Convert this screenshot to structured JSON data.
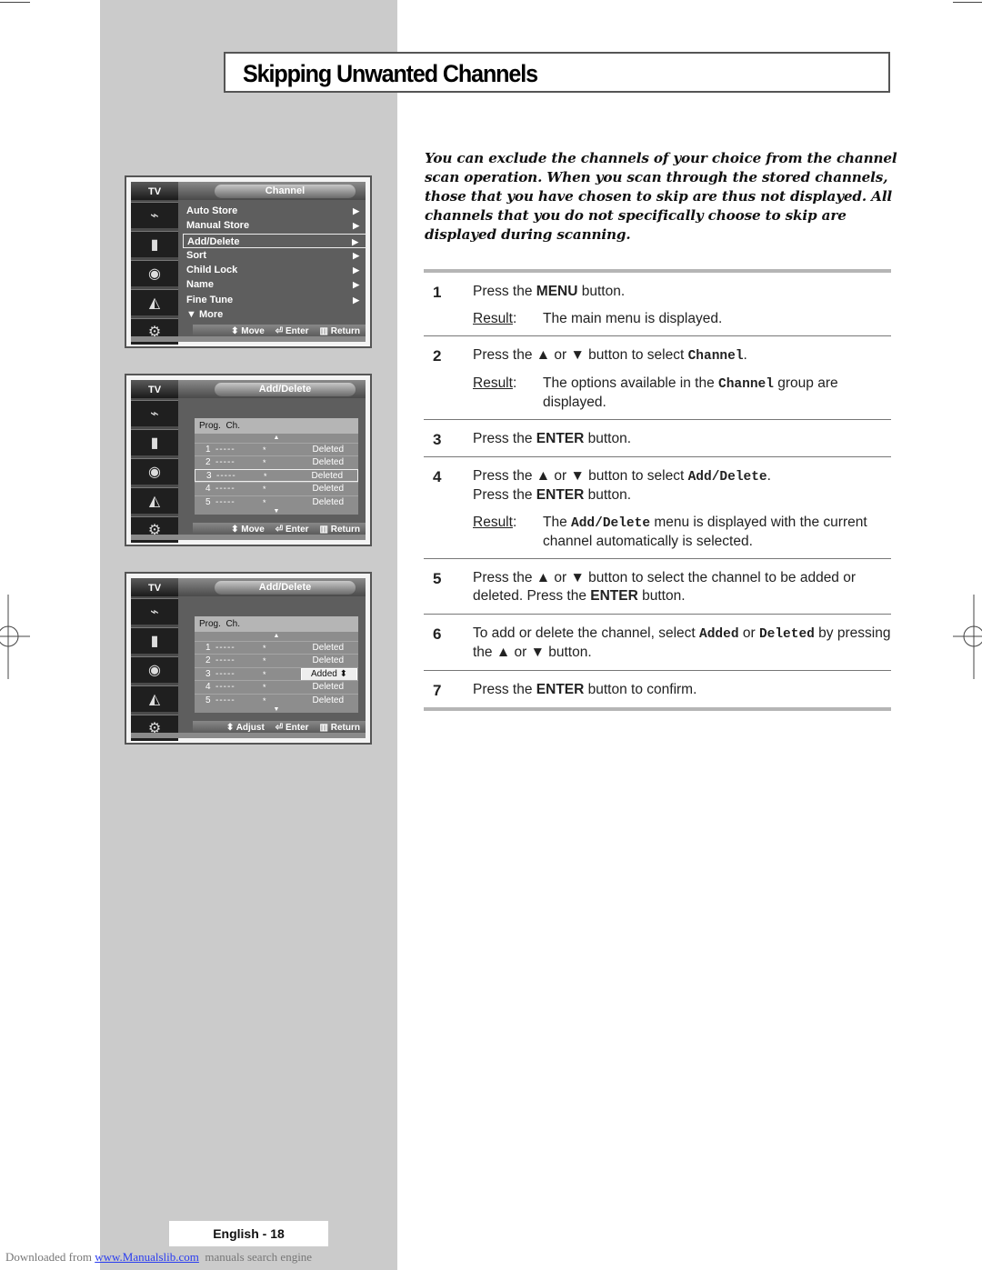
{
  "page": {
    "title": "Skipping Unwanted Channels",
    "intro": "You can exclude the channels of your choice from the channel scan operation. When you scan through the stored channels, those that you have chosen to skip are thus not displayed. All channels that you do not specifically choose to skip are displayed during scanning.",
    "page_number": "English - 18"
  },
  "steps": [
    {
      "num": "1",
      "parts": [
        [
          "Press the ",
          ""
        ],
        [
          "MENU",
          "b"
        ],
        [
          " button.",
          ""
        ]
      ],
      "result_label": "Result",
      "result": [
        [
          "The main menu is displayed.",
          ""
        ]
      ]
    },
    {
      "num": "2",
      "parts": [
        [
          "Press the ▲ or ▼ button to select ",
          ""
        ],
        [
          "Channel",
          "mono"
        ],
        [
          ".",
          ""
        ]
      ],
      "result_label": "Result",
      "result": [
        [
          "The options available in the ",
          ""
        ],
        [
          "Channel",
          "mono"
        ],
        [
          " group are displayed.",
          ""
        ]
      ]
    },
    {
      "num": "3",
      "parts": [
        [
          "Press the ",
          ""
        ],
        [
          "ENTER",
          "b"
        ],
        [
          " button.",
          ""
        ]
      ]
    },
    {
      "num": "4",
      "parts": [
        [
          "Press the ▲ or ▼ button to select ",
          ""
        ],
        [
          "Add/Delete",
          "mono"
        ],
        [
          ".",
          ""
        ],
        [
          "\n",
          "br"
        ],
        [
          "Press the ",
          ""
        ],
        [
          "ENTER",
          "b"
        ],
        [
          " button.",
          ""
        ]
      ],
      "result_label": "Result",
      "result": [
        [
          "The ",
          ""
        ],
        [
          "Add/Delete",
          "mono"
        ],
        [
          " menu is displayed with the current channel automatically is selected.",
          ""
        ]
      ]
    },
    {
      "num": "5",
      "parts": [
        [
          "Press the ▲ or ▼ button to select the channel to be added or deleted. Press the ",
          ""
        ],
        [
          "ENTER",
          "b"
        ],
        [
          " button.",
          ""
        ]
      ]
    },
    {
      "num": "6",
      "parts": [
        [
          "To add or delete the channel, select ",
          ""
        ],
        [
          "Added",
          "mono"
        ],
        [
          " or ",
          ""
        ],
        [
          "Deleted",
          "mono"
        ],
        [
          " by pressing the ▲ or ▼ button.",
          ""
        ]
      ]
    },
    {
      "num": "7",
      "parts": [
        [
          "Press the ",
          ""
        ],
        [
          "ENTER",
          "b"
        ],
        [
          " button to confirm.",
          ""
        ]
      ]
    }
  ],
  "screens": {
    "channel_menu": {
      "side_label": "TV",
      "tab": "Channel",
      "items": [
        {
          "label": "Auto Store",
          "arrow": "▶"
        },
        {
          "label": "Manual Store",
          "arrow": "▶"
        },
        {
          "label": "Add/Delete",
          "arrow": "▶",
          "selected": true
        },
        {
          "label": "Sort",
          "arrow": "▶"
        },
        {
          "label": "Child Lock",
          "arrow": "▶"
        },
        {
          "label": "Name",
          "arrow": "▶"
        },
        {
          "label": "Fine Tune",
          "arrow": "▶"
        },
        {
          "label": "▼ More",
          "arrow": ""
        }
      ],
      "footer": {
        "nav": "Move",
        "enter": "Enter",
        "return": "Return"
      }
    },
    "add_delete_1": {
      "side_label": "TV",
      "tab": "Add/Delete",
      "header": "Prog.  Ch.",
      "rows": [
        {
          "prog": "1",
          "ch": "-----",
          "star": "*",
          "status": "Deleted"
        },
        {
          "prog": "2",
          "ch": "-----",
          "star": "*",
          "status": "Deleted"
        },
        {
          "prog": "3",
          "ch": "-----",
          "star": "*",
          "status": "Deleted",
          "selected": true
        },
        {
          "prog": "4",
          "ch": "-----",
          "star": "*",
          "status": "Deleted"
        },
        {
          "prog": "5",
          "ch": "-----",
          "star": "*",
          "status": "Deleted"
        }
      ],
      "footer": {
        "nav": "Move",
        "enter": "Enter",
        "return": "Return"
      }
    },
    "add_delete_2": {
      "side_label": "TV",
      "tab": "Add/Delete",
      "header": "Prog.  Ch.",
      "rows": [
        {
          "prog": "1",
          "ch": "-----",
          "star": "*",
          "status": "Deleted"
        },
        {
          "prog": "2",
          "ch": "-----",
          "star": "*",
          "status": "Deleted"
        },
        {
          "prog": "3",
          "ch": "-----",
          "star": "*",
          "status": "Added",
          "editing": true
        },
        {
          "prog": "4",
          "ch": "-----",
          "star": "*",
          "status": "Deleted"
        },
        {
          "prog": "5",
          "ch": "-----",
          "star": "*",
          "status": "Deleted"
        }
      ],
      "footer": {
        "nav": "Adjust",
        "enter": "Enter",
        "return": "Return"
      }
    }
  },
  "footer": {
    "downloaded_prefix": "Downloaded from ",
    "link_text": "www.Manualslib.com",
    "suffix": "  manuals search engine"
  },
  "icons": {
    "updown": "⬍",
    "enter": "⏎",
    "return": "▥",
    "adjust_arrows": "⬍",
    "side_icons": [
      "antenna-icon",
      "picture-icon",
      "sound-icon",
      "channel-icon",
      "setup-icon"
    ]
  }
}
